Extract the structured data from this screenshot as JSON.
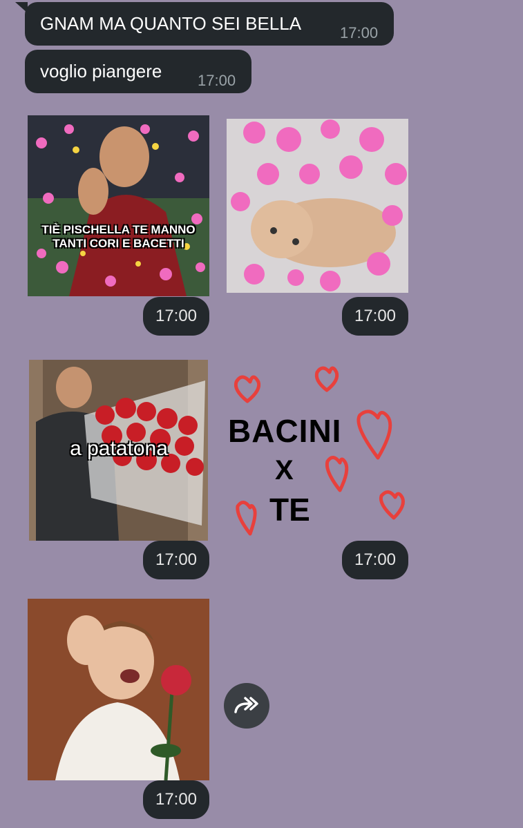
{
  "messages": [
    {
      "text": "GNAM MA QUANTO SEI BELLA",
      "time": "17:00"
    },
    {
      "text": "voglio piangere",
      "time": "17:00"
    }
  ],
  "stickers": [
    {
      "caption": "TIÈ PISCHELLA TE MANNO\nTANTI CORI E BACETTI",
      "time": "17:00"
    },
    {
      "time": "17:00"
    },
    {
      "caption": "a patatona",
      "time": "17:00"
    },
    {
      "line1": "BACINI",
      "line2": "X",
      "line3": "TE",
      "time": "17:00"
    },
    {
      "time": "17:00"
    }
  ],
  "colors": {
    "background": "#988ca8",
    "bubble": "#23282c",
    "heart_pink": "#f06bbf",
    "heart_red": "#e8403c"
  }
}
